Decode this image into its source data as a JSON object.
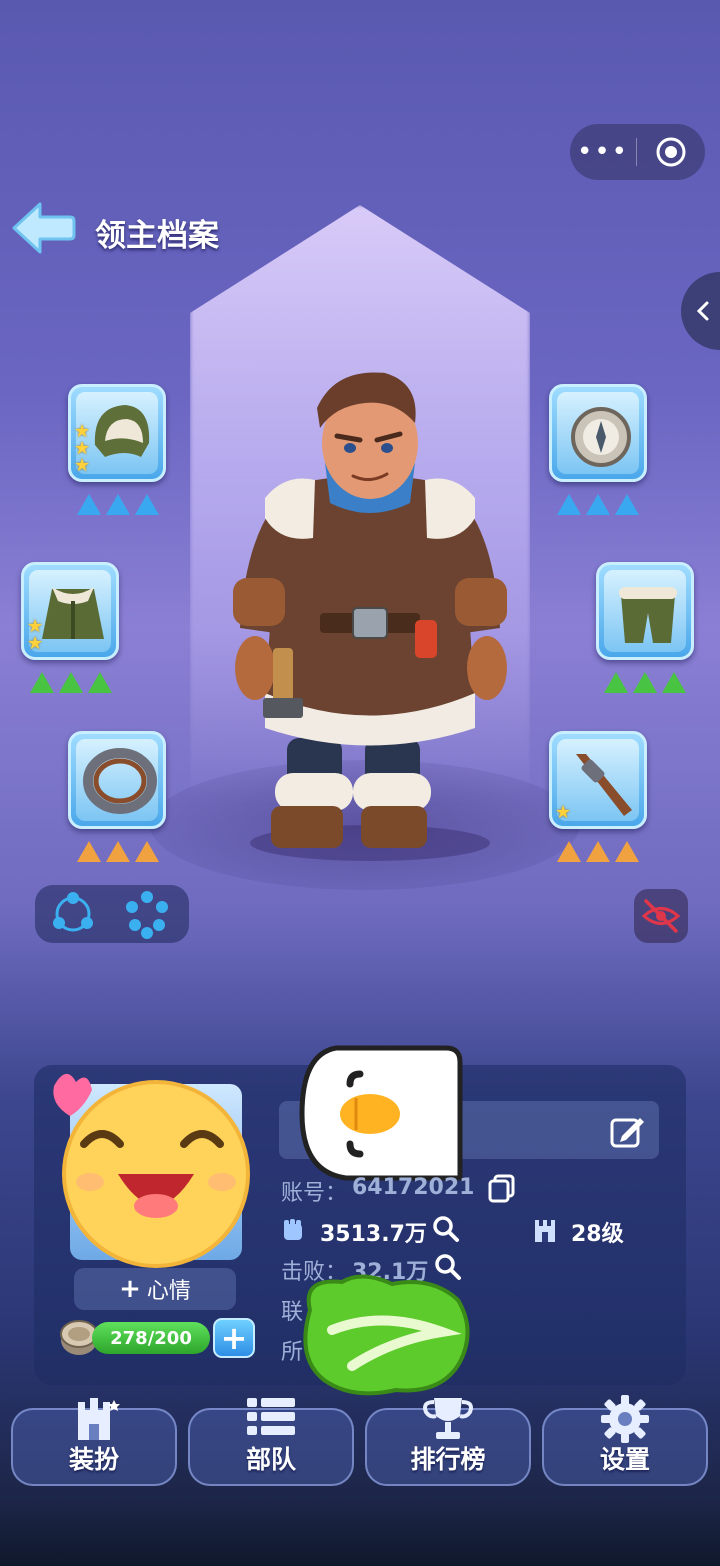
{
  "header": {
    "title": "领主档案",
    "menu_dots": "•••"
  },
  "equipment": {
    "left": [
      {
        "name": "hat",
        "stars": 3,
        "gem_color": "blue"
      },
      {
        "name": "coat",
        "stars": 2,
        "gem_color": "green"
      },
      {
        "name": "ring",
        "stars": 0,
        "gem_color": "orange"
      }
    ],
    "right": [
      {
        "name": "compass",
        "stars": 0,
        "gem_color": "blue"
      },
      {
        "name": "pants",
        "stars": 0,
        "gem_color": "green"
      },
      {
        "name": "wrench",
        "stars": 1,
        "gem_color": "orange"
      }
    ]
  },
  "profile": {
    "account_label": "账号：",
    "account_value": "64172021",
    "power_value": "3513.7万",
    "level_value": "28级",
    "defeat_label": "击败：",
    "defeat_value": "32.1万",
    "alliance_label": "联",
    "location_label": "所",
    "mood_label": "心情",
    "mood_plus": "+",
    "stamina": "278/200"
  },
  "nav": [
    {
      "label": "装扮",
      "icon": "castle-icon"
    },
    {
      "label": "部队",
      "icon": "list-icon"
    },
    {
      "label": "排行榜",
      "icon": "trophy-icon"
    },
    {
      "label": "设置",
      "icon": "gear-icon"
    }
  ],
  "colors": {
    "slot_blue": "#4aa7ea",
    "stamina_green": "#2da52b",
    "eye_red": "#e0364a"
  }
}
